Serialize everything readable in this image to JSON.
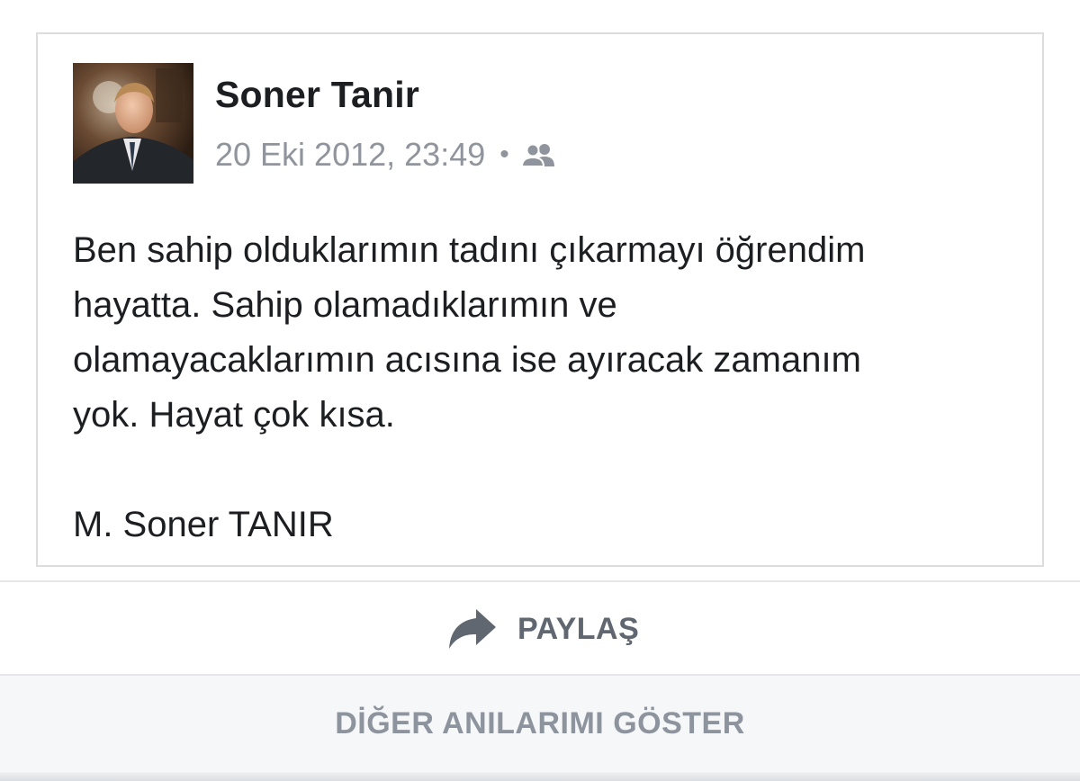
{
  "post": {
    "author": "Soner Tanir",
    "timestamp": "20 Eki 2012, 23:49",
    "separator": "•",
    "audience_icon": "friends-icon",
    "text": "Ben sahip olduklarımın tadını çıkarmayı öğrendim\nhayatta. Sahip olamadıklarımın ve\nolamayacaklarımın acısına ise ayıracak zamanım\nyok. Hayat çok kısa.\n\nM. Soner TANIR"
  },
  "actions": {
    "share_label": "PAYLAŞ",
    "share_icon": "share-arrow-icon",
    "more_memories_label": "DİĞER ANILARIMI GÖSTER"
  },
  "colors": {
    "primary_text": "#1c1e21",
    "secondary_text": "#90949c",
    "action_text": "#606770",
    "muted_action_text": "#8d949e",
    "border": "#dcdde0",
    "footer_bg": "#f6f7f8"
  }
}
